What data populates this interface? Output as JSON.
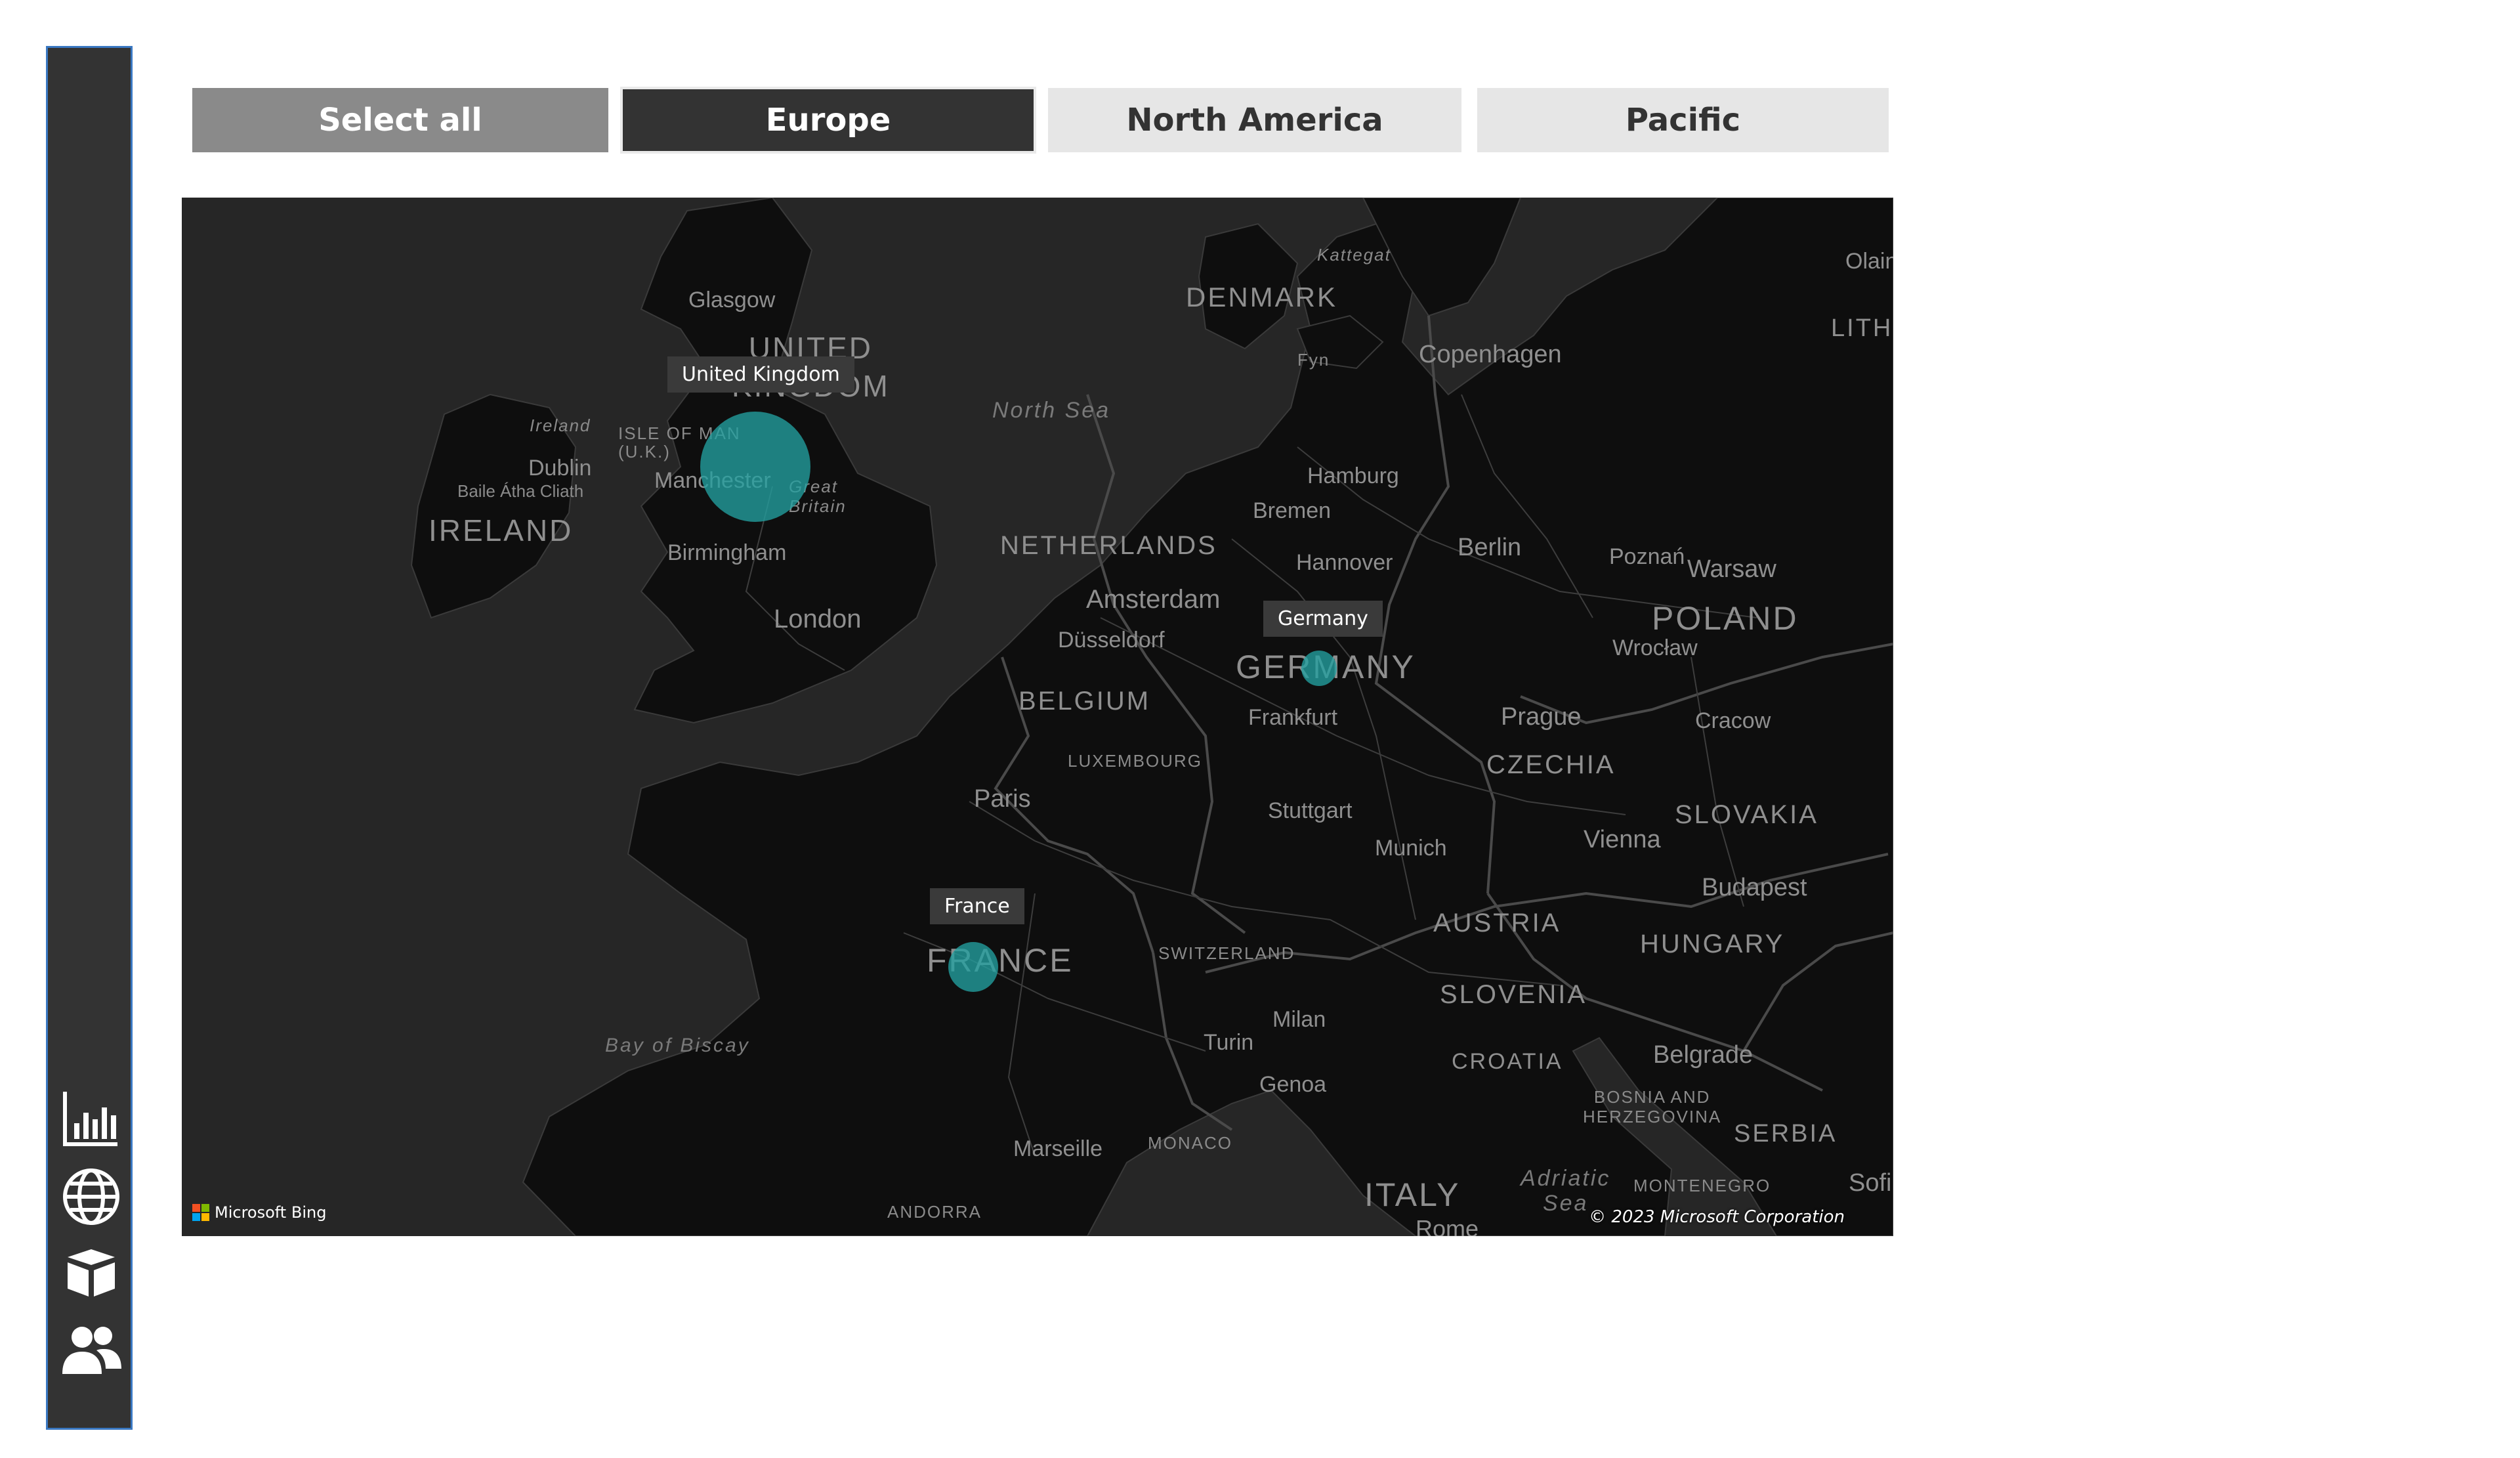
{
  "slicer": {
    "select_all": "Select all",
    "europe": "Europe",
    "north_america": "North America",
    "pacific": "Pacific",
    "selected": "Europe"
  },
  "nav": {
    "items": [
      {
        "icon": "bar-chart-icon"
      },
      {
        "icon": "globe-icon"
      },
      {
        "icon": "box-icon"
      },
      {
        "icon": "people-icon"
      }
    ]
  },
  "map": {
    "bubble_color": "#22a0a0",
    "points": [
      {
        "name": "United Kingdom",
        "size": 1.0
      },
      {
        "name": "Germany",
        "size": 0.32
      },
      {
        "name": "France",
        "size": 0.45
      }
    ],
    "labels": {
      "uk_country": "UNITED\nKINGDOM",
      "ireland": "IRELAND",
      "ireland_small": "Ireland",
      "isle_of_man": "ISLE OF MAN\n(U.K.)",
      "dublin": "Dublin",
      "baile": "Baile Átha Cliath",
      "glasgow": "Glasgow",
      "manchester": "Manchester",
      "great_britain": "Great\nBritain",
      "birmingham": "Birmingham",
      "london": "London",
      "north_sea": "North Sea",
      "denmark": "DENMARK",
      "kattegat": "Kattegat",
      "fyn": "Fyn",
      "copenhagen": "Copenhagen",
      "olain": "Olain",
      "lith": "LITHU",
      "hamburg": "Hamburg",
      "bremen": "Bremen",
      "netherlands": "NETHERLANDS",
      "hannover": "Hannover",
      "berlin": "Berlin",
      "poznan": "Poznań",
      "warsaw": "Warsaw",
      "poland": "POLAND",
      "amsterdam": "Amsterdam",
      "dusseldorf": "Düsseldorf",
      "germany": "GERMANY",
      "wroclaw": "Wrocław",
      "belgium": "BELGIUM",
      "frankfurt": "Frankfurt",
      "prague": "Prague",
      "cracow": "Cracow",
      "luxembourg": "LUXEMBOURG",
      "czechia": "CZECHIA",
      "paris": "Paris",
      "stuttgart": "Stuttgart",
      "slovakia": "SLOVAKIA",
      "munich": "Munich",
      "vienna": "Vienna",
      "budapest": "Budapest",
      "france": "FRANCE",
      "switzerland": "SWITZERLAND",
      "austria": "AUSTRIA",
      "hungary": "HUNGARY",
      "slovenia": "SLOVENIA",
      "milan": "Milan",
      "turin": "Turin",
      "croatia": "CROATIA",
      "belgrade": "Belgrade",
      "genoa": "Genoa",
      "bay_of_biscay": "Bay of Biscay",
      "bosnia": "BOSNIA AND\nHERZEGOVINA",
      "serbia": "SERBIA",
      "marseille": "Marseille",
      "monaco": "MONACO",
      "adriatic": "Adriatic\nSea",
      "italy": "ITALY",
      "montenegro": "MONTENEGRO",
      "sofi": "Sofi",
      "andorra": "ANDORRA",
      "rome": "Rome"
    },
    "bing": "Microsoft Bing",
    "copyright": "© 2023 Microsoft Corporation"
  }
}
